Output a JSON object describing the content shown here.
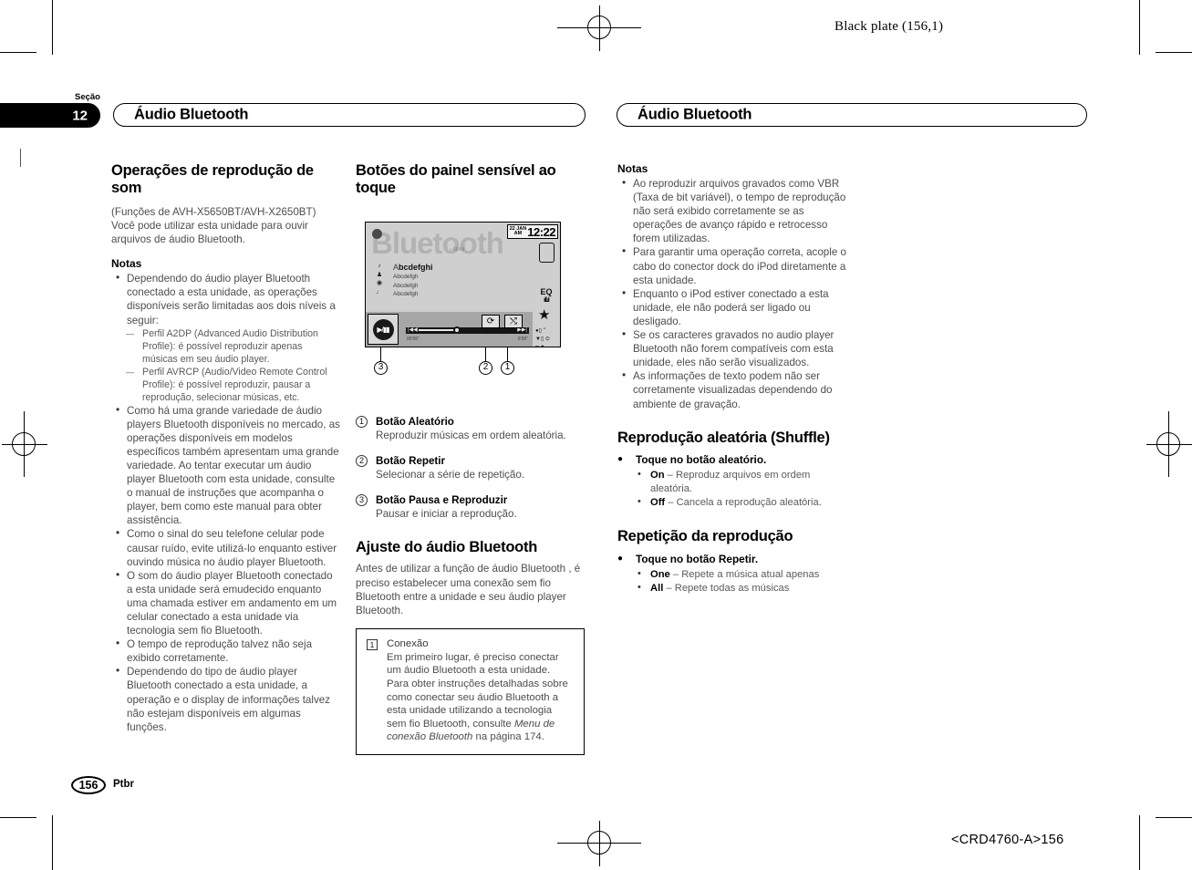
{
  "print": {
    "black_plate": "Black plate (156,1)",
    "doc_code": "<CRD4760-A>156"
  },
  "section_tab": {
    "label": "Seção",
    "number": "12"
  },
  "headers": {
    "left": "Áudio Bluetooth",
    "right": "Áudio Bluetooth"
  },
  "footer": {
    "page_number": "156",
    "language": "Ptbr"
  },
  "col1": {
    "heading": "Operações de reprodução de som",
    "intro1": "(Funções de AVH-X5650BT/AVH-X2650BT)",
    "intro2": "Você pode utilizar esta unidade para ouvir arquivos de áudio Bluetooth.",
    "notes_title": "Notas",
    "note1": "Dependendo do áudio player Bluetooth conectado a esta unidade, as operações disponíveis serão limitadas aos dois níveis a seguir:",
    "dash1": "Perfil A2DP (Advanced Audio Distribution Profile): é possível reproduzir apenas músicas em seu áudio player.",
    "dash2": "Perfil AVRCP (Audio/Video Remote Control Profile): é possível reproduzir, pausar a reprodução, selecionar músicas, etc.",
    "note2": "Como há uma grande variedade de áudio players Bluetooth disponíveis no mercado, as operações disponíveis em modelos específicos também apresentam uma grande variedade. Ao tentar executar um áudio player Bluetooth com esta unidade, consulte o manual de instruções que acompanha o player, bem como este manual para obter assistência.",
    "note3": "Como o sinal do seu telefone celular pode causar ruído, evite utilizá-lo enquanto estiver ouvindo música no áudio player Bluetooth.",
    "note4": "O som do áudio player Bluetooth conectado a esta unidade será emudecido enquanto uma chamada estiver em andamento em um celular conectado a esta unidade via tecnologia sem fio Bluetooth.",
    "note5": "O tempo de reprodução talvez não seja exibido corretamente.",
    "note6": "Dependendo do tipo de áudio player Bluetooth conectado a esta unidade, a operação e o display de informações talvez não estejam disponíveis em algumas funções."
  },
  "col2": {
    "heading": "Botões do painel sensível ao toque",
    "device": {
      "watermark": "Bluetooth",
      "clock_date": "22 JAN",
      "clock_ampm": "AM",
      "clock_time": "12:22",
      "note_label": "66:66",
      "track_title": "Abcdefghi",
      "track_line2": "Abcdefgh",
      "track_line3": "Abcdefgh",
      "track_line4": "Abcdefgh",
      "time_elapsed": "88'88\"",
      "time_total": "8'88\"",
      "left_icons": [
        "♪",
        "♟",
        "◉",
        "♩"
      ],
      "right_icons": [
        "phone-icon",
        "eq-icon",
        "star-icon"
      ],
      "eq_label": "EQ",
      "btn_repeat_icon": "repeat-icon",
      "btn_shuffle_icon": "shuffle-icon",
      "btn_play_icon": "play-pause-icon",
      "callouts": [
        "1",
        "2",
        "3"
      ]
    },
    "items": [
      {
        "n": "1",
        "title": "Botão Aleatório",
        "desc": "Reproduzir músicas em ordem aleatória."
      },
      {
        "n": "2",
        "title": "Botão Repetir",
        "desc": "Selecionar a série de repetição."
      },
      {
        "n": "3",
        "title": "Botão Pausa e Reproduzir",
        "desc": "Pausar e iniciar a reprodução."
      }
    ],
    "heading2": "Ajuste do áudio Bluetooth",
    "para2": "Antes de utilizar a função de áudio Bluetooth , é preciso estabelecer uma conexão sem fio Bluetooth entre a unidade e seu áudio player Bluetooth.",
    "box": {
      "marker": "1",
      "title": "Conexão",
      "line1": "Em primeiro lugar, é preciso conectar um áudio Bluetooth a esta unidade.",
      "line2a": "Para obter instruções detalhadas sobre como conectar seu áudio Bluetooth a esta unidade utilizando a tecnologia sem fio Bluetooth, consulte ",
      "line2b": "Menu de conexão Bluetooth",
      "line2c": " na página 174."
    }
  },
  "col3": {
    "notes_title": "Notas",
    "note1": "Ao reproduzir arquivos gravados como VBR (Taxa de bit variável), o tempo de reprodução não será exibido corretamente se as operações de avanço rápido e retrocesso forem utilizadas.",
    "note2": "Para garantir uma operação correta, acople o cabo do conector dock do iPod diretamente a esta unidade.",
    "note3": "Enquanto o iPod estiver conectado a esta unidade, ele não poderá ser ligado ou desligado.",
    "note4": "Se os caracteres gravados no audio player Bluetooth não forem compatíveis com esta unidade, eles não serão visualizados.",
    "note5": "As informações de texto podem não ser corretamente visualizadas dependendo do ambiente de gravação.",
    "heading_shuffle": "Reprodução aleatória (Shuffle)",
    "op_shuffle": "Toque no botão aleatório.",
    "shuffle_on_label": "On",
    "shuffle_on_desc": " – Reproduz arquivos em ordem aleatória.",
    "shuffle_off_label": "Off",
    "shuffle_off_desc": " – Cancela a reprodução aleatória.",
    "heading_repeat": "Repetição da reprodução",
    "op_repeat": "Toque no botão Repetir.",
    "repeat_one_label": "One",
    "repeat_one_desc": " – Repete a música atual apenas",
    "repeat_all_label": "All",
    "repeat_all_desc": " – Repete todas as músicas"
  }
}
